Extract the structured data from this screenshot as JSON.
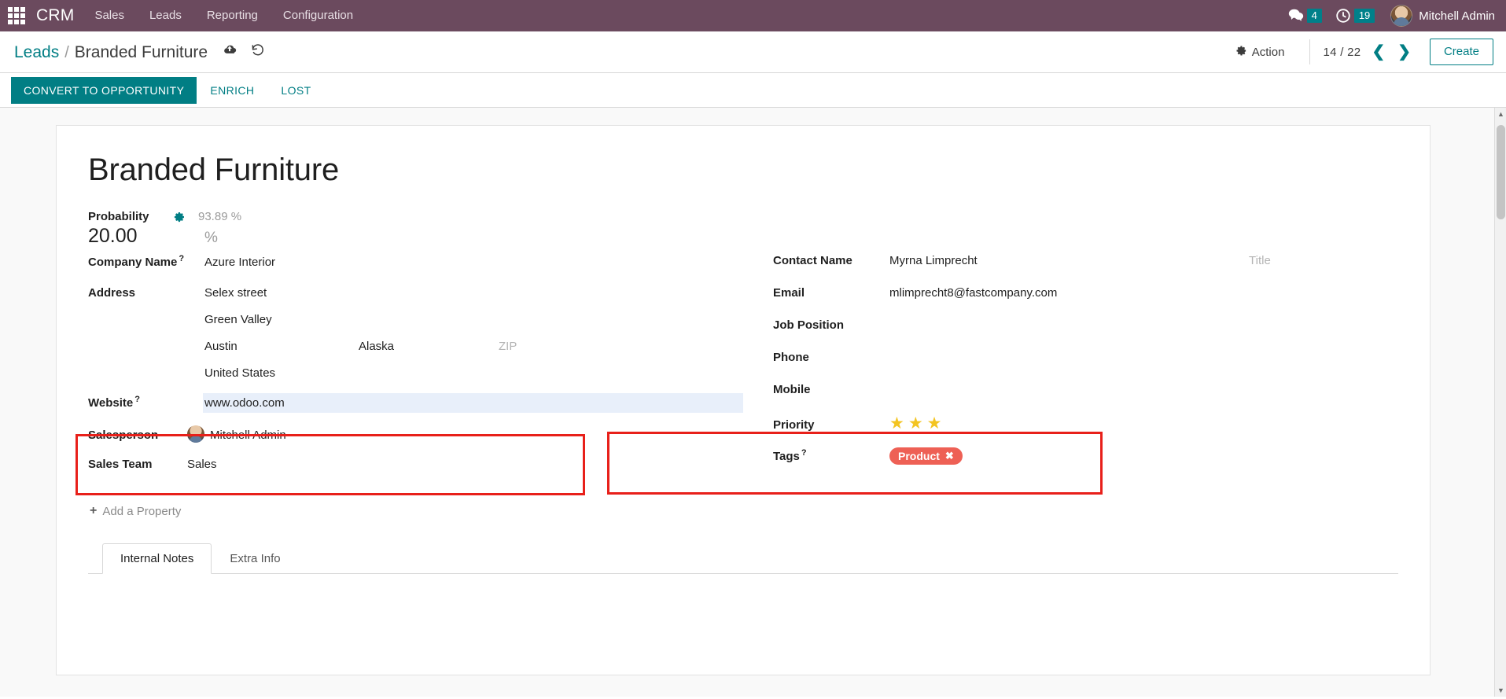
{
  "navbar": {
    "apps_icon": "apps-grid-icon",
    "brand": "CRM",
    "menu": [
      {
        "label": "Sales"
      },
      {
        "label": "Leads"
      },
      {
        "label": "Reporting"
      },
      {
        "label": "Configuration"
      }
    ],
    "systray": {
      "messages_icon": "chat-bubble-icon",
      "messages_count": "4",
      "activities_icon": "clock-icon",
      "activities_count": "19",
      "avatar_icon": "user-avatar",
      "user_name": "Mitchell Admin"
    }
  },
  "control_panel": {
    "breadcrumb_root": "Leads",
    "breadcrumb_sep": "/",
    "breadcrumb_current": "Branded Furniture",
    "save_icon": "cloud-upload-icon",
    "discard_icon": "undo-icon",
    "action_icon": "gear-icon",
    "action_label": "Action",
    "pager_value": "14 / 22",
    "pager_prev_icon": "chevron-left-icon",
    "pager_next_icon": "chevron-right-icon",
    "create_label": "Create"
  },
  "statusbar": {
    "buttons": [
      {
        "label": "CONVERT TO OPPORTUNITY",
        "style": "primary"
      },
      {
        "label": "ENRICH",
        "style": "link"
      },
      {
        "label": "LOST",
        "style": "link"
      }
    ]
  },
  "form": {
    "title": "Branded Furniture",
    "probability": {
      "label": "Probability",
      "gear_icon": "gear-icon",
      "auto_value": "93.89 %",
      "value": "20.00",
      "suffix": "%"
    },
    "left": {
      "company_name": {
        "label": "Company Name",
        "help": "?",
        "value": "Azure Interior"
      },
      "address": {
        "label": "Address",
        "street": "Selex street",
        "street2": "Green Valley",
        "city": "Austin",
        "state": "Alaska",
        "zip_placeholder": "ZIP",
        "country": "United States"
      },
      "website": {
        "label": "Website",
        "help": "?",
        "value": "www.odoo.com"
      },
      "salesperson": {
        "label": "Salesperson",
        "avatar_icon": "user-avatar",
        "value": "Mitchell Admin"
      },
      "sales_team": {
        "label": "Sales Team",
        "value": "Sales"
      }
    },
    "right": {
      "contact_name": {
        "label": "Contact Name",
        "value": "Myrna Limprecht",
        "title_placeholder": "Title"
      },
      "email": {
        "label": "Email",
        "value": "mlimprecht8@fastcompany.com"
      },
      "job_position": {
        "label": "Job Position",
        "value": ""
      },
      "phone": {
        "label": "Phone",
        "value": ""
      },
      "mobile": {
        "label": "Mobile",
        "value": ""
      },
      "priority": {
        "label": "Priority",
        "stars_filled": 3,
        "star_icon": "star-icon",
        "star_glyph": "★"
      },
      "tags": {
        "label": "Tags",
        "help": "?",
        "items": [
          {
            "label": "Product",
            "remove_icon": "close-icon",
            "remove_glyph": "✖"
          }
        ]
      }
    },
    "add_property": {
      "plus": "+",
      "label": "Add a Property"
    },
    "notebook_tabs": [
      {
        "label": "Internal Notes",
        "active": true
      },
      {
        "label": "Extra Info",
        "active": false
      }
    ]
  },
  "colors": {
    "navbar_bg": "#6b4a5e",
    "accent_teal": "#017e84",
    "annotation_red": "#e8201a",
    "star_gold": "#f3c421",
    "tag_red": "#ee6055",
    "highlight_blue": "#e8effa"
  }
}
